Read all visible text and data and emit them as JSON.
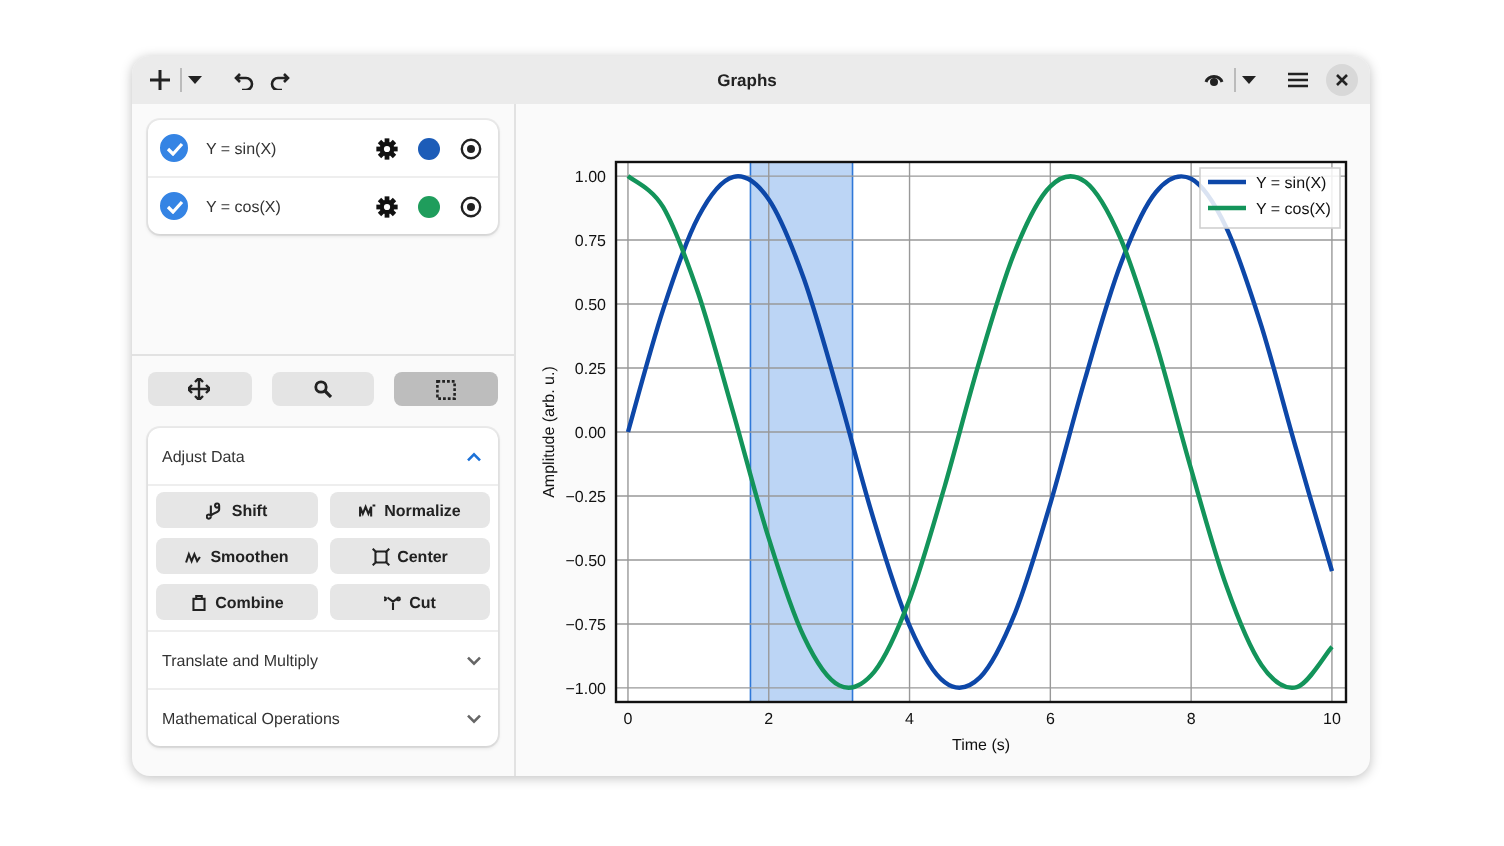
{
  "window": {
    "title": "Graphs"
  },
  "items": [
    {
      "label": "Y = sin(X)",
      "checked": true,
      "color": "#1c5cb8"
    },
    {
      "label": "Y = cos(X)",
      "checked": true,
      "color": "#1f9d5c"
    }
  ],
  "tools": [
    {
      "kind": "pan",
      "selected": false
    },
    {
      "kind": "zoom",
      "selected": false
    },
    {
      "kind": "select",
      "selected": true
    }
  ],
  "sections": [
    {
      "title": "Adjust Data",
      "expanded": true,
      "buttons": [
        {
          "kind": "shift",
          "label": "Shift"
        },
        {
          "kind": "normalize",
          "label": "Normalize"
        },
        {
          "kind": "smoothen",
          "label": "Smoothen"
        },
        {
          "kind": "center",
          "label": "Center"
        },
        {
          "kind": "combine",
          "label": "Combine"
        },
        {
          "kind": "cut",
          "label": "Cut"
        }
      ]
    },
    {
      "title": "Translate and Multiply",
      "expanded": false
    },
    {
      "title": "Mathematical Operations",
      "expanded": false
    }
  ],
  "chart_data": {
    "type": "line",
    "xlabel": "Time (s)",
    "ylabel": "Amplitude (arb. u.)",
    "x": [
      0,
      0.5,
      1,
      1.5,
      2,
      2.5,
      3,
      3.5,
      4,
      4.5,
      5,
      5.5,
      6,
      6.5,
      7,
      7.5,
      8,
      8.5,
      9,
      9.5,
      10
    ],
    "series": [
      {
        "name": "Y = sin(X)",
        "color": "#0d47a8",
        "values": [
          0,
          0.479,
          0.841,
          0.997,
          0.909,
          0.598,
          0.141,
          -0.351,
          -0.757,
          -0.978,
          -0.959,
          -0.706,
          -0.279,
          0.215,
          0.657,
          0.938,
          0.989,
          0.798,
          0.412,
          -0.075,
          -0.544
        ]
      },
      {
        "name": "Y = cos(X)",
        "color": "#13945a",
        "values": [
          1,
          0.878,
          0.54,
          0.071,
          -0.416,
          -0.801,
          -0.99,
          -0.936,
          -0.654,
          -0.211,
          0.284,
          0.709,
          0.96,
          0.977,
          0.754,
          0.347,
          -0.146,
          -0.602,
          -0.911,
          -0.997,
          -0.839
        ]
      }
    ],
    "xlim": [
      -0.17,
      10.2
    ],
    "ylim": [
      -1.055,
      1.055
    ],
    "xticks": [
      0,
      2,
      4,
      6,
      8,
      10
    ],
    "yticks": [
      {
        "value": 1,
        "label": "1.00"
      },
      {
        "value": 0.75,
        "label": "0.75"
      },
      {
        "value": 0.5,
        "label": "0.50"
      },
      {
        "value": 0.25,
        "label": "0.25"
      },
      {
        "value": 0,
        "label": "0.00"
      },
      {
        "value": -0.25,
        "label": "−0.25"
      },
      {
        "value": -0.5,
        "label": "−0.50"
      },
      {
        "value": -0.75,
        "label": "−0.75"
      },
      {
        "value": -1,
        "label": "−1.00"
      }
    ],
    "grid": true,
    "legend": "upper right",
    "bands": [
      {
        "axis": "x",
        "from": 1.74,
        "to": 3.19
      }
    ]
  }
}
